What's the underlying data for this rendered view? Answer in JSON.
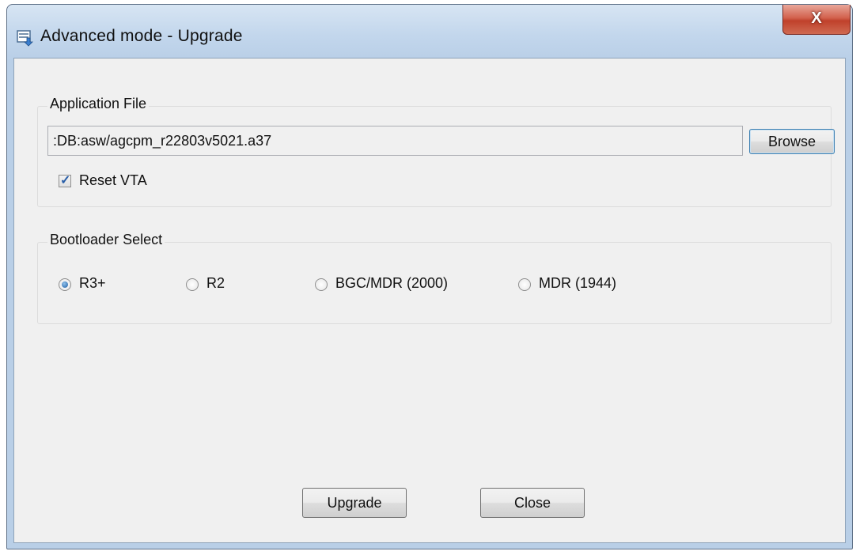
{
  "window": {
    "title": "Advanced mode - Upgrade",
    "close_label": "X"
  },
  "application_file": {
    "group_label": "Application File",
    "path_value": ":DB:asw/agcpm_r22803v5021.a37",
    "browse_label": "Browse",
    "reset_vta": {
      "label": "Reset VTA",
      "checked": true
    }
  },
  "bootloader_select": {
    "group_label": "Bootloader Select",
    "options": [
      {
        "label": "R3+",
        "checked": true
      },
      {
        "label": "R2",
        "checked": false
      },
      {
        "label": "BGC/MDR (2000)",
        "checked": false
      },
      {
        "label": "MDR (1944)",
        "checked": false
      }
    ]
  },
  "actions": {
    "upgrade_label": "Upgrade",
    "close_label": "Close"
  },
  "icons": {
    "app_icon": "upgrade-window-icon",
    "close_icon": "close-icon",
    "check_icon": "checkmark-icon"
  }
}
